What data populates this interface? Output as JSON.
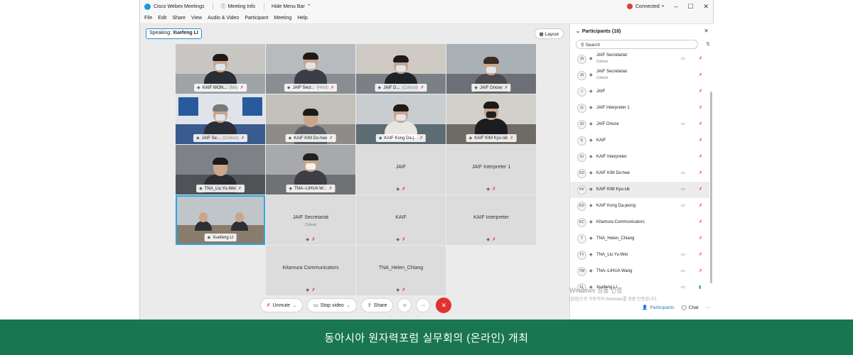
{
  "app": {
    "title": "Cisco Webex Meetings",
    "meeting_info": "Meeting Info",
    "hide_menu": "Hide Menu Bar",
    "connection": "Connected",
    "menu": [
      "File",
      "Edit",
      "Share",
      "View",
      "Audio & Video",
      "Participant",
      "Meeting",
      "Help"
    ]
  },
  "meeting": {
    "speaking_label": "Speaking:",
    "speaking_name": "Xuefeng LI",
    "layout_label": "Layout",
    "tiles": [
      {
        "name": "KAIF WON...",
        "role": "(Me)",
        "type": "video"
      },
      {
        "name": "JAIF Secr...",
        "role": "(Host)",
        "type": "video"
      },
      {
        "name": "JAIF D...",
        "role": "(Cohost)",
        "type": "video"
      },
      {
        "name": "JAIF Onose",
        "role": "",
        "type": "video"
      },
      {
        "name": "JAIF Se...",
        "role": "(Cohost)",
        "type": "video"
      },
      {
        "name": "KAIF KIM Do-hee",
        "role": "",
        "type": "video"
      },
      {
        "name": "KAIF Kong Da-j...",
        "role": "",
        "type": "video"
      },
      {
        "name": "KAIF KIM Kyu-sik",
        "role": "",
        "type": "video"
      },
      {
        "name": "TNA_Liu Yu-Wei",
        "role": "",
        "type": "video"
      },
      {
        "name": "TNA--LIHUA W...",
        "role": "",
        "type": "video"
      },
      {
        "name": "JAIF",
        "sub": "",
        "type": "blank"
      },
      {
        "name": "JAIF Interpreter 1",
        "sub": "",
        "type": "blank"
      },
      {
        "name": "Xuefeng LI",
        "role": "",
        "type": "video-active"
      },
      {
        "name": "JAIF Secretariat",
        "sub": "Cohost",
        "type": "blank"
      },
      {
        "name": "KAIF",
        "sub": "",
        "type": "blank"
      },
      {
        "name": "KAIF Interpreter",
        "sub": "",
        "type": "blank"
      },
      {
        "name": "Kitamura Communicators",
        "sub": "",
        "type": "blank"
      },
      {
        "name": "TNA_Helen_Chiang",
        "sub": "",
        "type": "blank"
      }
    ]
  },
  "controls": {
    "unmute": "Unmute",
    "stop_video": "Stop video",
    "share": "Share"
  },
  "participants": {
    "title": "Participants (18)",
    "search_placeholder": "Search",
    "list": [
      {
        "initials": "JS",
        "name": "JAIF Secretariat",
        "sub": "Cohost",
        "video": true,
        "mic": "muted"
      },
      {
        "initials": "JS",
        "name": "JAIF Secretariat",
        "sub": "Cohost",
        "video": false,
        "mic": "muted"
      },
      {
        "initials": "J",
        "name": "JAIF",
        "sub": "",
        "video": false,
        "mic": "muted"
      },
      {
        "initials": "J1",
        "name": "JAIF Interpreter 1",
        "sub": "",
        "video": false,
        "mic": "muted"
      },
      {
        "initials": "JO",
        "name": "JAIF Onose",
        "sub": "",
        "video": true,
        "mic": "muted"
      },
      {
        "initials": "K",
        "name": "KAIF",
        "sub": "",
        "video": false,
        "mic": "muted"
      },
      {
        "initials": "KI",
        "name": "KAIF Interpreter",
        "sub": "",
        "video": false,
        "mic": "muted"
      },
      {
        "initials": "KD",
        "name": "KAIF KIM Do-hee",
        "sub": "",
        "video": true,
        "mic": "muted"
      },
      {
        "initials": "KK",
        "name": "KAIF KIM Kyu-sik",
        "sub": "",
        "video": true,
        "mic": "muted"
      },
      {
        "initials": "KD",
        "name": "KAIF Kong Da-jeong",
        "sub": "",
        "video": true,
        "mic": "muted"
      },
      {
        "initials": "KC",
        "name": "Kitamura Communicators",
        "sub": "",
        "video": false,
        "mic": "muted"
      },
      {
        "initials": "T",
        "name": "TNA_Helen_Chiang",
        "sub": "",
        "video": false,
        "mic": "muted"
      },
      {
        "initials": "TY",
        "name": "TNA_Liu Yu-Wei",
        "sub": "",
        "video": true,
        "mic": "muted"
      },
      {
        "initials": "TW",
        "name": "TNA--LIHUA Wang",
        "sub": "",
        "video": true,
        "mic": "muted"
      },
      {
        "initials": "XL",
        "name": "Xuefeng LI",
        "sub": "",
        "video": true,
        "mic": "active"
      }
    ],
    "footer_participants": "Participants",
    "footer_chat": "Chat"
  },
  "watermark": {
    "line1": "Windows 정품 인증",
    "line2": "[설정]으로 이동하여 Windows를 정품 인증합니다."
  },
  "caption": "동아시아 원자력포럼 실무회의 (온라인) 개최",
  "colors": {
    "accent": "#29a7e1",
    "mic_muted": "#e03a3a",
    "end_call": "#e0322f",
    "caption_bg": "#19764e"
  }
}
